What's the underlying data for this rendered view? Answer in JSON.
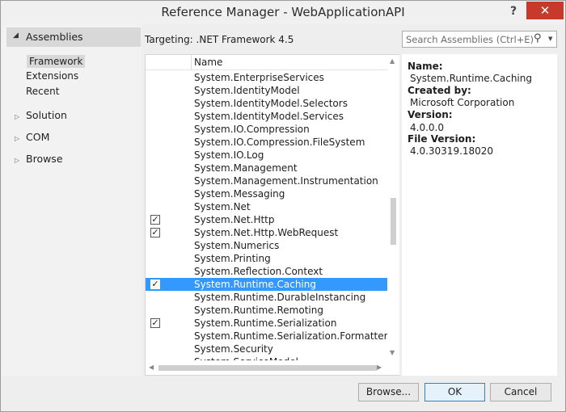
{
  "window": {
    "title": "Reference Manager - WebApplicationAPI",
    "help": "?",
    "close": "✕"
  },
  "nav": {
    "header": "Assemblies",
    "subitems": [
      "Framework",
      "Extensions",
      "Recent"
    ],
    "groups": [
      "Solution",
      "COM",
      "Browse"
    ]
  },
  "targeting": "Targeting: .NET Framework 4.5",
  "list": {
    "column_name": "Name",
    "rows": [
      {
        "name": "System.EnterpriseServices",
        "checked": false
      },
      {
        "name": "System.IdentityModel",
        "checked": false
      },
      {
        "name": "System.IdentityModel.Selectors",
        "checked": false
      },
      {
        "name": "System.IdentityModel.Services",
        "checked": false
      },
      {
        "name": "System.IO.Compression",
        "checked": false
      },
      {
        "name": "System.IO.Compression.FileSystem",
        "checked": false
      },
      {
        "name": "System.IO.Log",
        "checked": false
      },
      {
        "name": "System.Management",
        "checked": false
      },
      {
        "name": "System.Management.Instrumentation",
        "checked": false
      },
      {
        "name": "System.Messaging",
        "checked": false
      },
      {
        "name": "System.Net",
        "checked": false
      },
      {
        "name": "System.Net.Http",
        "checked": true
      },
      {
        "name": "System.Net.Http.WebRequest",
        "checked": true
      },
      {
        "name": "System.Numerics",
        "checked": false
      },
      {
        "name": "System.Printing",
        "checked": false
      },
      {
        "name": "System.Reflection.Context",
        "checked": false
      },
      {
        "name": "System.Runtime.Caching",
        "checked": true,
        "selected": true
      },
      {
        "name": "System.Runtime.DurableInstancing",
        "checked": false
      },
      {
        "name": "System.Runtime.Remoting",
        "checked": false
      },
      {
        "name": "System.Runtime.Serialization",
        "checked": true
      },
      {
        "name": "System.Runtime.Serialization.Formatters.Soap",
        "checked": false
      },
      {
        "name": "System.Security",
        "checked": false
      },
      {
        "name": "System.ServiceModel",
        "checked": false
      }
    ]
  },
  "search": {
    "placeholder": "Search Assemblies (Ctrl+E)"
  },
  "details": {
    "name_label": "Name:",
    "name_value": "System.Runtime.Caching",
    "created_label": "Created by:",
    "created_value": "Microsoft Corporation",
    "version_label": "Version:",
    "version_value": "4.0.0.0",
    "file_version_label": "File Version:",
    "file_version_value": "4.0.30319.18020"
  },
  "buttons": {
    "browse": "Browse...",
    "ok": "OK",
    "cancel": "Cancel"
  },
  "colors": {
    "selection": "#3399ff",
    "close": "#c7392b"
  }
}
